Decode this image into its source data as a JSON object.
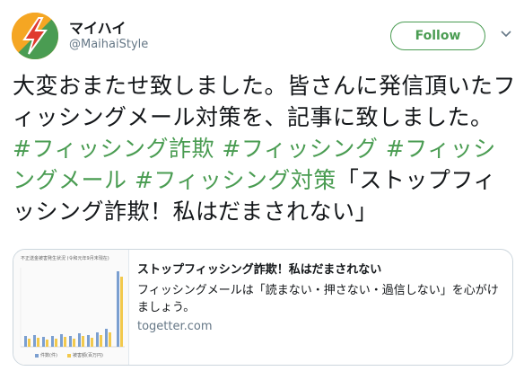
{
  "user": {
    "name": "マイハイ",
    "handle": "@MaihaiStyle",
    "avatar_icon": "lightning-bolt-logo"
  },
  "follow_button": {
    "label": "Follow"
  },
  "menu": {
    "icon": "chevron-down-icon"
  },
  "tweet": {
    "text": "大変おまたせ致しました。皆さんに発信頂いたフィッシングメール対策を、記事に致しました。",
    "hashtags": [
      "#フィッシング詐欺",
      "#フィッシング",
      "#フィッシングメール",
      "#フィッシング対策"
    ],
    "quote": "「ストップフィッシング詐欺！私はだまされない」"
  },
  "card": {
    "thumb_title": "不正送金被害発生状況 (令和元年9月末現在)",
    "thumb_legend_a": "件数(件)",
    "thumb_legend_b": "被害額(百万円)",
    "title": "ストップフィッシング詐欺！私はだまされない",
    "description": "フィッシングメールは「読まない・押さない・過信しない」を心がけましょう。",
    "domain": "togetter.com"
  },
  "colors": {
    "accent": "#4a9c52",
    "avatar_orange": "#f5a623",
    "avatar_red": "#e03a2f",
    "muted": "#657786",
    "border": "#ccd6dd"
  }
}
